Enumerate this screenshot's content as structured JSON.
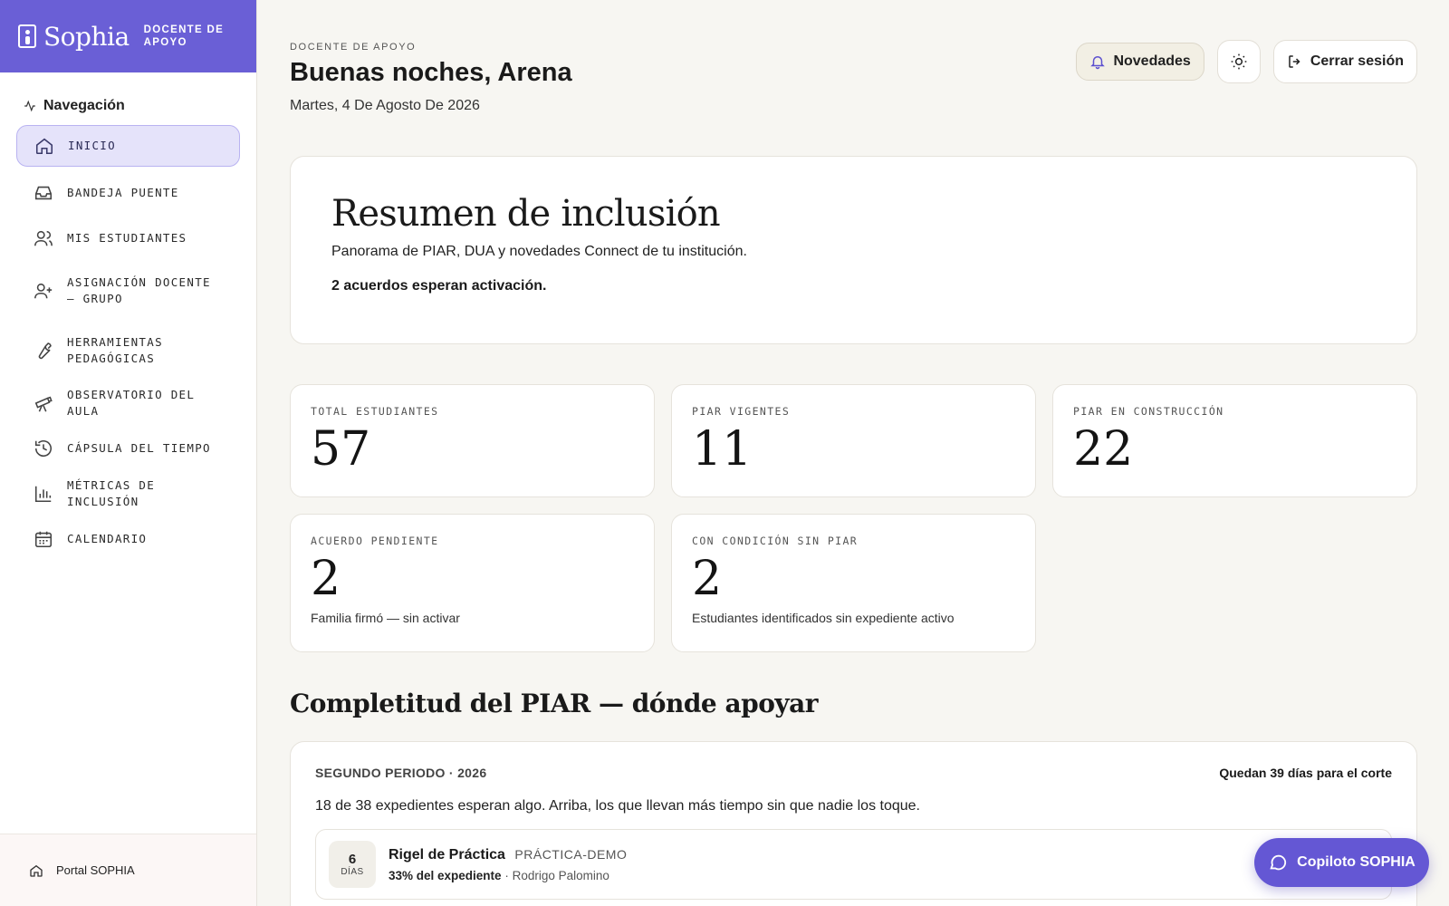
{
  "brand": {
    "name": "Sophia",
    "role": "DOCENTE DE APOYO"
  },
  "nav": {
    "title": "Navegación",
    "items": [
      {
        "label": "INICIO",
        "icon": "home-icon",
        "active": true
      },
      {
        "label": "BANDEJA PUENTE",
        "icon": "inbox-icon"
      },
      {
        "label": "MIS ESTUDIANTES",
        "icon": "users-icon"
      },
      {
        "label": "ASIGNACIÓN DOCENTE — GRUPO",
        "icon": "user-plus-icon"
      },
      {
        "label": "HERRAMIENTAS PEDAGÓGICAS",
        "icon": "wrench-icon"
      },
      {
        "label": "OBSERVATORIO DEL AULA",
        "icon": "telescope-icon"
      },
      {
        "label": "CÁPSULA DEL TIEMPO",
        "icon": "history-icon"
      },
      {
        "label": "MÉTRICAS DE INCLUSIÓN",
        "icon": "bar-chart-icon"
      },
      {
        "label": "CALENDARIO",
        "icon": "calendar-icon"
      }
    ],
    "footer": "Portal SOPHIA"
  },
  "header": {
    "eyebrow": "DOCENTE DE APOYO",
    "greeting": "Buenas noches, Arena",
    "date": "Martes, 4 De Agosto De 2026",
    "news_label": "Novedades",
    "logout_label": "Cerrar sesión"
  },
  "hero": {
    "title": "Resumen de inclusión",
    "subtitle": "Panorama de PIAR, DUA y novedades Connect de tu institución.",
    "note": "2 acuerdos esperan activación."
  },
  "stats": [
    {
      "label": "TOTAL ESTUDIANTES",
      "value": "57",
      "desc": ""
    },
    {
      "label": "PIAR VIGENTES",
      "value": "11",
      "desc": ""
    },
    {
      "label": "PIAR EN CONSTRUCCIÓN",
      "value": "22",
      "desc": ""
    },
    {
      "label": "ACUERDO PENDIENTE",
      "value": "2",
      "desc": "Familia firmó — sin activar"
    },
    {
      "label": "CON CONDICIÓN SIN PIAR",
      "value": "2",
      "desc": "Estudiantes identificados sin expediente activo"
    }
  ],
  "completeness": {
    "title": "Completitud del PIAR — dónde apoyar",
    "period": "SEGUNDO PERIODO · 2026",
    "deadline": "Quedan 39 días para el corte",
    "summary": "18 de 38 expedientes esperan algo. Arriba, los que llevan más tiempo sin que nadie los toque.",
    "rows": [
      {
        "days": "6",
        "days_unit": "DÍAS",
        "name": "Rigel de Práctica",
        "tag": "PRÁCTICA-DEMO",
        "progress": "33% del expediente",
        "teacher": "· Rodrigo Palomino"
      }
    ]
  },
  "copilot": {
    "label": "Copiloto SOPHIA"
  },
  "colors": {
    "brand": "#6a5fd6",
    "active_nav": "#e5e3fa",
    "copilot": "#6457d4"
  }
}
